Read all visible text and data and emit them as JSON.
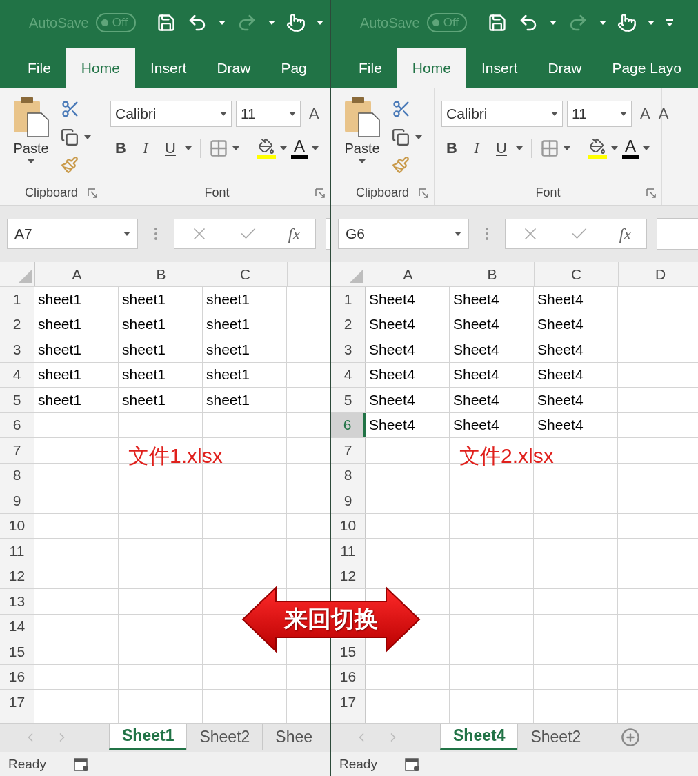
{
  "windows": [
    {
      "quick_access": {
        "autosave": "AutoSave",
        "toggle": "Off",
        "icons": [
          {
            "kind": "save",
            "dropdown": false
          },
          {
            "kind": "undo",
            "dropdown": true
          },
          {
            "kind": "redo",
            "dropdown": true
          },
          {
            "kind": "touch",
            "dropdown": true
          }
        ]
      },
      "tabs": [
        {
          "label": "File",
          "selected": false
        },
        {
          "label": "Home",
          "selected": true
        },
        {
          "label": "Insert",
          "selected": false
        },
        {
          "label": "Draw",
          "selected": false
        },
        {
          "label": "Pag",
          "selected": false
        }
      ],
      "ribbon": {
        "paste": "Paste",
        "clipboard": "Clipboard",
        "font_name": "Calibri",
        "font_size": "11",
        "grow_font": "A",
        "font_styles": [
          "B",
          "I",
          "U"
        ],
        "font_color": "A",
        "font": "Font"
      },
      "formula_bar": {
        "name_box": "A7",
        "fx": "fx"
      },
      "columns": [
        "A",
        "B",
        "C"
      ],
      "rows": [
        {
          "header": "1",
          "selected": false,
          "cells": [
            "sheet1",
            "sheet1",
            "sheet1"
          ]
        },
        {
          "header": "2",
          "selected": false,
          "cells": [
            "sheet1",
            "sheet1",
            "sheet1"
          ]
        },
        {
          "header": "3",
          "selected": false,
          "cells": [
            "sheet1",
            "sheet1",
            "sheet1"
          ]
        },
        {
          "header": "4",
          "selected": false,
          "cells": [
            "sheet1",
            "sheet1",
            "sheet1"
          ]
        },
        {
          "header": "5",
          "selected": false,
          "cells": [
            "sheet1",
            "sheet1",
            "sheet1"
          ]
        },
        {
          "header": "6",
          "selected": false,
          "cells": []
        },
        {
          "header": "7",
          "selected": false,
          "cells": [],
          "note": "文件1.xlsx"
        },
        {
          "header": "8",
          "selected": false,
          "cells": []
        },
        {
          "header": "9",
          "selected": false,
          "cells": []
        },
        {
          "header": "10",
          "selected": false,
          "cells": []
        },
        {
          "header": "11",
          "selected": false,
          "cells": []
        },
        {
          "header": "12",
          "selected": false,
          "cells": []
        },
        {
          "header": "13",
          "selected": false,
          "cells": []
        },
        {
          "header": "14",
          "selected": false,
          "cells": []
        },
        {
          "header": "15",
          "selected": false,
          "cells": []
        },
        {
          "header": "16",
          "selected": false,
          "cells": []
        },
        {
          "header": "17",
          "selected": false,
          "cells": []
        }
      ],
      "sheet_tabs": [
        {
          "label": "Sheet1",
          "selected": true
        },
        {
          "label": "Sheet2",
          "selected": false
        },
        {
          "label": "Shee",
          "selected": false
        }
      ],
      "status": "Ready"
    },
    {
      "quick_access": {
        "autosave": "AutoSave",
        "toggle": "Off",
        "icons": [
          {
            "kind": "save",
            "dropdown": false
          },
          {
            "kind": "undo",
            "dropdown": true
          },
          {
            "kind": "redo",
            "dropdown": true
          },
          {
            "kind": "touch",
            "dropdown": true
          },
          {
            "kind": "customize",
            "dropdown": false
          }
        ]
      },
      "tabs": [
        {
          "label": "File",
          "selected": false
        },
        {
          "label": "Home",
          "selected": true
        },
        {
          "label": "Insert",
          "selected": false
        },
        {
          "label": "Draw",
          "selected": false
        },
        {
          "label": "Page Layo",
          "selected": false
        }
      ],
      "ribbon": {
        "paste": "Paste",
        "clipboard": "Clipboard",
        "font_name": "Calibri",
        "font_size": "11",
        "grow_font": "A",
        "shrink_font": "A",
        "font_styles": [
          "B",
          "I",
          "U"
        ],
        "font_color": "A",
        "font": "Font"
      },
      "formula_bar": {
        "name_box": "G6",
        "fx": "fx"
      },
      "columns": [
        "A",
        "B",
        "C",
        "D"
      ],
      "rows": [
        {
          "header": "1",
          "selected": false,
          "cells": [
            "Sheet4",
            "Sheet4",
            "Sheet4"
          ]
        },
        {
          "header": "2",
          "selected": false,
          "cells": [
            "Sheet4",
            "Sheet4",
            "Sheet4"
          ]
        },
        {
          "header": "3",
          "selected": false,
          "cells": [
            "Sheet4",
            "Sheet4",
            "Sheet4"
          ]
        },
        {
          "header": "4",
          "selected": false,
          "cells": [
            "Sheet4",
            "Sheet4",
            "Sheet4"
          ]
        },
        {
          "header": "5",
          "selected": false,
          "cells": [
            "Sheet4",
            "Sheet4",
            "Sheet4"
          ]
        },
        {
          "header": "6",
          "selected": true,
          "cells": [
            "Sheet4",
            "Sheet4",
            "Sheet4"
          ]
        },
        {
          "header": "7",
          "selected": false,
          "cells": [],
          "note": "文件2.xlsx"
        },
        {
          "header": "8",
          "selected": false,
          "cells": []
        },
        {
          "header": "9",
          "selected": false,
          "cells": []
        },
        {
          "header": "10",
          "selected": false,
          "cells": []
        },
        {
          "header": "11",
          "selected": false,
          "cells": []
        },
        {
          "header": "12",
          "selected": false,
          "cells": []
        },
        {
          "cells": []
        },
        {
          "cells": []
        },
        {
          "header": "15",
          "selected": false,
          "cells": []
        },
        {
          "header": "16",
          "selected": false,
          "cells": []
        },
        {
          "header": "17",
          "selected": false,
          "cells": []
        }
      ],
      "sheet_tabs": [
        {
          "label": "Sheet4",
          "selected": true
        },
        {
          "label": "Sheet2",
          "selected": false
        }
      ],
      "add_sheet": true,
      "status": "Ready"
    }
  ],
  "switch_arrow": {
    "label": "来回切换"
  }
}
